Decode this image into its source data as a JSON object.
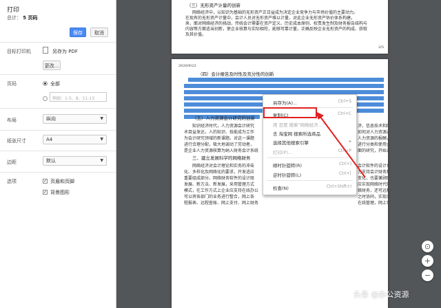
{
  "dialog": {
    "title": "打印",
    "total_label": "总计：",
    "total_value": "5 页码",
    "save_label": "保存",
    "cancel_label": "取消",
    "destination_label": "目标打印机",
    "destination_value": "另存为 PDF",
    "change_label": "更改...",
    "pages_label": "页码",
    "pages_all": "全部",
    "pages_placeholder": "例如：1-5、8、11-13",
    "layout_label": "布局",
    "layout_value": "纵向",
    "paper_label": "纸张尺寸",
    "paper_value": "A4",
    "margins_label": "边距",
    "margins_value": "默认",
    "options_label": "选项",
    "option_headers": "页眉和页脚",
    "option_background": "背景图形"
  },
  "document": {
    "page1_heading": "（三）无形资产计量的创新",
    "page1_lines": [
      "网络经济中，以知识为基础的无形资产正日益成为决定企业竞争力与市场价值的主要动力。",
      "在现有的无形资产计量中，会计人员对无形资产难以计量，对此企业无形资产估价体系构建。",
      "来，面对网络经济的挑战，传统会计需要在资产定义、历史成本原则、权责发生制及财务报告结构与",
      "内容等方面适当创新，使企业核算与实际相符，能够可靠计量，正确反映企业无形资产的构成、获取",
      "及其价值。"
    ],
    "page1_number": "3/5",
    "page2_header": "2020/9/23",
    "page2_heading": "（四）会计报告及时性及充分性的创新",
    "page2_para2_heading": "（五）人力资源会计研究的创新",
    "page2_para3_heading": "三、建立发展科学的网络财务",
    "page2_lines": [
      "知识经济时代，人力资源会计研究",
      "术目益发达，人的知识、技能成为工作",
      "为会计研究领域的新课题。对这一课题",
      "进行合理分配，极大地调动了劳动者，",
      "是企业人力资源核算为纳入财务会计系统"
    ],
    "page2_lines_right": [
      "济，信息技术和网络技术目益新技",
      "如何对人力资源进行会计核算成",
      "人力资源的报酬，把人力资源，使",
      "进行分类和使用企业资源，具",
      "面的研究，开始设。"
    ],
    "page2_lines_b": [
      "网络经济对会计理论和实务的冲击",
      "化、多样化及网络化的要求，开发适应",
      "重要组成部分。网络财务软件的设计既",
      "发展、新方法、新发展，采用管理方式",
      "模式，在工作方式上企业应支持在线办公",
      "可以将各部门的业务进行整合，网上各",
      "程报表、远程查账、网上支付、网上财务"
    ],
    "page2_lines_b_right": [
      "会计软件的设计也要适应这种会计复杂",
      "力支持会计财务软件，也是网络经济的",
      "变化，也要兼顾网络财务软件的研究基础",
      "应实现网络时代财务管理模式的转变，",
      "络财务，还可远程调阅和传递数据",
      "之时协同，实现动态会计核算、实",
      "在线管理，网上审计、网上服务。"
    ]
  },
  "context_menu": {
    "items": [
      {
        "label": "另存为(A)...",
        "shortcut": "Ctrl+S",
        "disabled": false
      },
      {
        "label": "复制(C)",
        "shortcut": "Ctrl+C",
        "disabled": false
      },
      {
        "label": "用 百度 搜索\"网络经济…\"",
        "shortcut": "",
        "disabled": true
      },
      {
        "label": "去 淘宝网 搜索所选商品",
        "shortcut": "",
        "disabled": false
      },
      {
        "label": "选择其他搜索引擎",
        "shortcut": "",
        "disabled": false
      },
      {
        "label": "打印(P)...",
        "shortcut": "Ctrl+P",
        "disabled": true
      },
      {
        "label": "顺时针旋转(R)",
        "shortcut": "Ctrl+]",
        "disabled": false
      },
      {
        "label": "逆时针旋转(L)",
        "shortcut": "Ctrl+[",
        "disabled": false
      },
      {
        "label": "检查(N)",
        "shortcut": "Ctrl+Shift+I",
        "disabled": false
      }
    ]
  },
  "watermark": "头条 @办公资源",
  "colors": {
    "accent": "#4a8af4",
    "highlight": "#3a7fd5",
    "annotation": "#e02020",
    "viewer_bg": "#525659"
  },
  "icons": [
    "document-icon",
    "fit-page-icon",
    "zoom-in-icon",
    "zoom-out-icon",
    "arrow-annotation-icon"
  ]
}
